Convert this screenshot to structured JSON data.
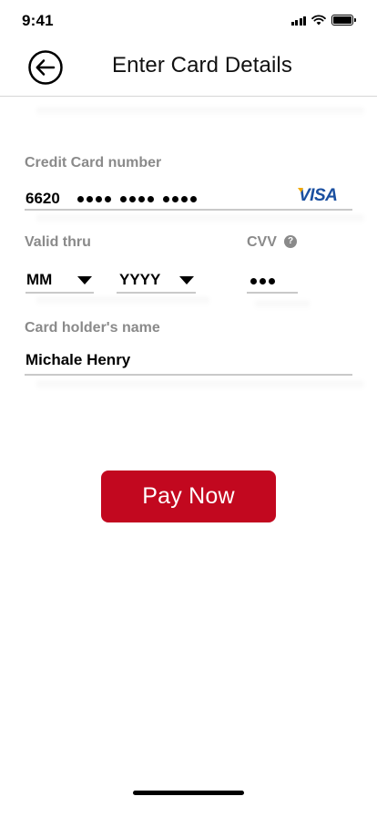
{
  "status_bar": {
    "time": "9:41"
  },
  "header": {
    "title": "Enter Card Details",
    "back_icon": "arrow-left-circle-icon"
  },
  "card_number": {
    "label": "Credit Card number",
    "visible_digits": "6620",
    "masked_groups": 3,
    "brand": "VISA"
  },
  "valid_thru": {
    "label": "Valid thru",
    "month_value": "MM",
    "year_value": "YYYY"
  },
  "cvv": {
    "label": "CVV",
    "masked_digits": 3,
    "help_icon": "question-circle-icon"
  },
  "card_holder": {
    "label": "Card holder's name",
    "value": "Michale Henry"
  },
  "pay_button": {
    "label": "Pay Now",
    "color": "#c2081f"
  },
  "colors": {
    "label_gray": "#8a8a8a",
    "brand_blue": "#1a4fa0"
  }
}
